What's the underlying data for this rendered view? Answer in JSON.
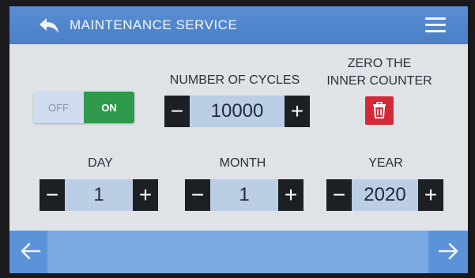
{
  "header": {
    "title": "MAINTENANCE SERVICE",
    "back_icon": "back-arrow-icon",
    "menu_icon": "hamburger-menu-icon"
  },
  "toggle": {
    "off_label": "OFF",
    "on_label": "ON",
    "state": "on"
  },
  "cycles": {
    "label": "NUMBER OF CYCLES",
    "minus": "−",
    "value": "10000",
    "plus": "+"
  },
  "zero_counter": {
    "label_line1": "ZERO THE",
    "label_line2": "INNER COUNTER",
    "icon": "trash-icon"
  },
  "day": {
    "label": "DAY",
    "minus": "−",
    "value": "1",
    "plus": "+"
  },
  "month": {
    "label": "MONTH",
    "minus": "−",
    "value": "1",
    "plus": "+"
  },
  "year": {
    "label": "YEAR",
    "minus": "−",
    "value": "2020",
    "plus": "+"
  },
  "footer": {
    "prev_icon": "arrow-left-icon",
    "next_icon": "arrow-right-icon"
  },
  "colors": {
    "header": "#4a7fc6",
    "toggle_on": "#2e9a4c",
    "delete": "#d42a37",
    "stepper_button": "#1c1f24",
    "stepper_value": "#bccde6"
  }
}
